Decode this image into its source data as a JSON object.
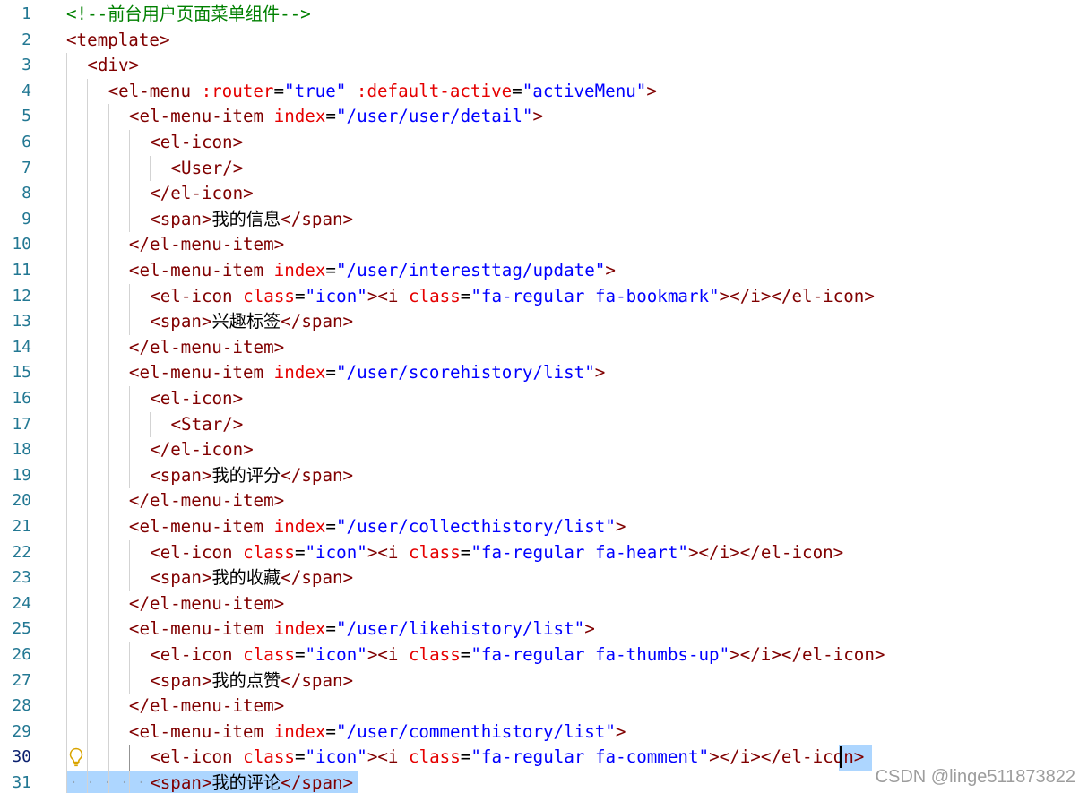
{
  "editor": {
    "current_line": 30,
    "colors": {
      "comment": "#008000",
      "tag": "#800000",
      "attr": "#e50000",
      "string": "#0000ff",
      "text": "#000000",
      "line_number": "#237893",
      "selection": "#add6ff"
    },
    "lines": [
      {
        "n": "1",
        "indent": 0,
        "tokens": [
          {
            "t": "c",
            "v": "<!--前台用户页面菜单组件-->"
          }
        ]
      },
      {
        "n": "2",
        "indent": 0,
        "tokens": [
          {
            "t": "tag",
            "v": "<template>"
          }
        ]
      },
      {
        "n": "3",
        "indent": 1,
        "tokens": [
          {
            "t": "tag",
            "v": "<div>"
          }
        ]
      },
      {
        "n": "4",
        "indent": 2,
        "tokens": [
          {
            "t": "tag",
            "v": "<el-menu"
          },
          {
            "t": "x",
            "v": " "
          },
          {
            "t": "attr",
            "v": ":router"
          },
          {
            "t": "x",
            "v": "="
          },
          {
            "t": "str",
            "v": "\"true\""
          },
          {
            "t": "x",
            "v": " "
          },
          {
            "t": "attr",
            "v": ":default-active"
          },
          {
            "t": "x",
            "v": "="
          },
          {
            "t": "str",
            "v": "\"activeMenu\""
          },
          {
            "t": "tag",
            "v": ">"
          }
        ]
      },
      {
        "n": "5",
        "indent": 3,
        "tokens": [
          {
            "t": "tag",
            "v": "<el-menu-item"
          },
          {
            "t": "x",
            "v": " "
          },
          {
            "t": "attr",
            "v": "index"
          },
          {
            "t": "x",
            "v": "="
          },
          {
            "t": "str",
            "v": "\"/user/user/detail\""
          },
          {
            "t": "tag",
            "v": ">"
          }
        ]
      },
      {
        "n": "6",
        "indent": 4,
        "tokens": [
          {
            "t": "tag",
            "v": "<el-icon>"
          }
        ]
      },
      {
        "n": "7",
        "indent": 5,
        "tokens": [
          {
            "t": "tag",
            "v": "<User/>"
          }
        ]
      },
      {
        "n": "8",
        "indent": 4,
        "tokens": [
          {
            "t": "tag",
            "v": "</el-icon>"
          }
        ]
      },
      {
        "n": "9",
        "indent": 4,
        "tokens": [
          {
            "t": "tag",
            "v": "<span>"
          },
          {
            "t": "x",
            "v": "我的信息"
          },
          {
            "t": "tag",
            "v": "</span>"
          }
        ]
      },
      {
        "n": "10",
        "indent": 3,
        "tokens": [
          {
            "t": "tag",
            "v": "</el-menu-item>"
          }
        ]
      },
      {
        "n": "11",
        "indent": 3,
        "tokens": [
          {
            "t": "tag",
            "v": "<el-menu-item"
          },
          {
            "t": "x",
            "v": " "
          },
          {
            "t": "attr",
            "v": "index"
          },
          {
            "t": "x",
            "v": "="
          },
          {
            "t": "str",
            "v": "\"/user/interesttag/update\""
          },
          {
            "t": "tag",
            "v": ">"
          }
        ]
      },
      {
        "n": "12",
        "indent": 4,
        "tokens": [
          {
            "t": "tag",
            "v": "<el-icon"
          },
          {
            "t": "x",
            "v": " "
          },
          {
            "t": "attr",
            "v": "class"
          },
          {
            "t": "x",
            "v": "="
          },
          {
            "t": "str",
            "v": "\"icon\""
          },
          {
            "t": "tag",
            "v": "><i"
          },
          {
            "t": "x",
            "v": " "
          },
          {
            "t": "attr",
            "v": "class"
          },
          {
            "t": "x",
            "v": "="
          },
          {
            "t": "str",
            "v": "\"fa-regular fa-bookmark\""
          },
          {
            "t": "tag",
            "v": "></i></el-icon>"
          }
        ]
      },
      {
        "n": "13",
        "indent": 4,
        "tokens": [
          {
            "t": "tag",
            "v": "<span>"
          },
          {
            "t": "x",
            "v": "兴趣标签"
          },
          {
            "t": "tag",
            "v": "</span>"
          }
        ]
      },
      {
        "n": "14",
        "indent": 3,
        "tokens": [
          {
            "t": "tag",
            "v": "</el-menu-item>"
          }
        ]
      },
      {
        "n": "15",
        "indent": 3,
        "tokens": [
          {
            "t": "tag",
            "v": "<el-menu-item"
          },
          {
            "t": "x",
            "v": " "
          },
          {
            "t": "attr",
            "v": "index"
          },
          {
            "t": "x",
            "v": "="
          },
          {
            "t": "str",
            "v": "\"/user/scorehistory/list\""
          },
          {
            "t": "tag",
            "v": ">"
          }
        ]
      },
      {
        "n": "16",
        "indent": 4,
        "tokens": [
          {
            "t": "tag",
            "v": "<el-icon>"
          }
        ]
      },
      {
        "n": "17",
        "indent": 5,
        "tokens": [
          {
            "t": "tag",
            "v": "<Star/>"
          }
        ]
      },
      {
        "n": "18",
        "indent": 4,
        "tokens": [
          {
            "t": "tag",
            "v": "</el-icon>"
          }
        ]
      },
      {
        "n": "19",
        "indent": 4,
        "tokens": [
          {
            "t": "tag",
            "v": "<span>"
          },
          {
            "t": "x",
            "v": "我的评分"
          },
          {
            "t": "tag",
            "v": "</span>"
          }
        ]
      },
      {
        "n": "20",
        "indent": 3,
        "tokens": [
          {
            "t": "tag",
            "v": "</el-menu-item>"
          }
        ]
      },
      {
        "n": "21",
        "indent": 3,
        "tokens": [
          {
            "t": "tag",
            "v": "<el-menu-item"
          },
          {
            "t": "x",
            "v": " "
          },
          {
            "t": "attr",
            "v": "index"
          },
          {
            "t": "x",
            "v": "="
          },
          {
            "t": "str",
            "v": "\"/user/collecthistory/list\""
          },
          {
            "t": "tag",
            "v": ">"
          }
        ]
      },
      {
        "n": "22",
        "indent": 4,
        "tokens": [
          {
            "t": "tag",
            "v": "<el-icon"
          },
          {
            "t": "x",
            "v": " "
          },
          {
            "t": "attr",
            "v": "class"
          },
          {
            "t": "x",
            "v": "="
          },
          {
            "t": "str",
            "v": "\"icon\""
          },
          {
            "t": "tag",
            "v": "><i"
          },
          {
            "t": "x",
            "v": " "
          },
          {
            "t": "attr",
            "v": "class"
          },
          {
            "t": "x",
            "v": "="
          },
          {
            "t": "str",
            "v": "\"fa-regular fa-heart\""
          },
          {
            "t": "tag",
            "v": "></i></el-icon>"
          }
        ]
      },
      {
        "n": "23",
        "indent": 4,
        "tokens": [
          {
            "t": "tag",
            "v": "<span>"
          },
          {
            "t": "x",
            "v": "我的收藏"
          },
          {
            "t": "tag",
            "v": "</span>"
          }
        ]
      },
      {
        "n": "24",
        "indent": 3,
        "tokens": [
          {
            "t": "tag",
            "v": "</el-menu-item>"
          }
        ]
      },
      {
        "n": "25",
        "indent": 3,
        "tokens": [
          {
            "t": "tag",
            "v": "<el-menu-item"
          },
          {
            "t": "x",
            "v": " "
          },
          {
            "t": "attr",
            "v": "index"
          },
          {
            "t": "x",
            "v": "="
          },
          {
            "t": "str",
            "v": "\"/user/likehistory/list\""
          },
          {
            "t": "tag",
            "v": ">"
          }
        ]
      },
      {
        "n": "26",
        "indent": 4,
        "tokens": [
          {
            "t": "tag",
            "v": "<el-icon"
          },
          {
            "t": "x",
            "v": " "
          },
          {
            "t": "attr",
            "v": "class"
          },
          {
            "t": "x",
            "v": "="
          },
          {
            "t": "str",
            "v": "\"icon\""
          },
          {
            "t": "tag",
            "v": "><i"
          },
          {
            "t": "x",
            "v": " "
          },
          {
            "t": "attr",
            "v": "class"
          },
          {
            "t": "x",
            "v": "="
          },
          {
            "t": "str",
            "v": "\"fa-regular fa-thumbs-up\""
          },
          {
            "t": "tag",
            "v": "></i></el-icon>"
          }
        ]
      },
      {
        "n": "27",
        "indent": 4,
        "tokens": [
          {
            "t": "tag",
            "v": "<span>"
          },
          {
            "t": "x",
            "v": "我的点赞"
          },
          {
            "t": "tag",
            "v": "</span>"
          }
        ]
      },
      {
        "n": "28",
        "indent": 3,
        "tokens": [
          {
            "t": "tag",
            "v": "</el-menu-item>"
          }
        ]
      },
      {
        "n": "29",
        "indent": 3,
        "tokens": [
          {
            "t": "tag",
            "v": "<el-menu-item"
          },
          {
            "t": "x",
            "v": " "
          },
          {
            "t": "attr",
            "v": "index"
          },
          {
            "t": "x",
            "v": "="
          },
          {
            "t": "str",
            "v": "\"/user/commenthistory/list\""
          },
          {
            "t": "tag",
            "v": ">"
          }
        ]
      },
      {
        "n": "30",
        "indent": 4,
        "tokens": [
          {
            "t": "tag",
            "v": "<el-icon"
          },
          {
            "t": "x",
            "v": " "
          },
          {
            "t": "attr",
            "v": "class"
          },
          {
            "t": "x",
            "v": "="
          },
          {
            "t": "str",
            "v": "\"icon\""
          },
          {
            "t": "tag",
            "v": "><i"
          },
          {
            "t": "x",
            "v": " "
          },
          {
            "t": "attr",
            "v": "class"
          },
          {
            "t": "x",
            "v": "="
          },
          {
            "t": "str",
            "v": "\"fa-regular fa-comment\""
          },
          {
            "t": "tag",
            "v": "></i></el-icon>"
          }
        ]
      },
      {
        "n": "31",
        "indent": 4,
        "tokens": [
          {
            "t": "tag",
            "v": "<span>"
          },
          {
            "t": "x",
            "v": "我的评论"
          },
          {
            "t": "tag",
            "v": "</span>"
          }
        ]
      }
    ]
  },
  "lightbulb_icon": "lightbulb-icon",
  "watermark": "CSDN @linge511873822"
}
